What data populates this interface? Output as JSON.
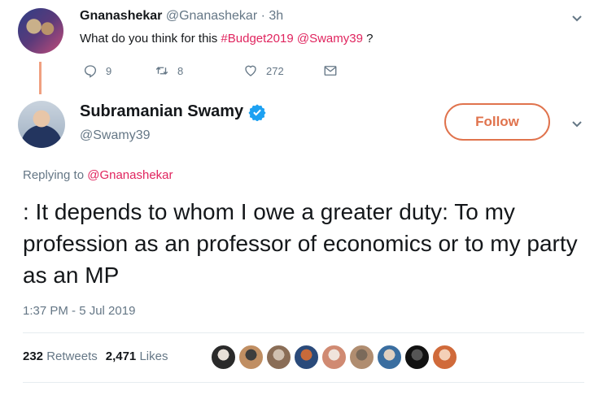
{
  "tweet1": {
    "name": "Gnanashekar",
    "meta": "@Gnanashekar · 3h",
    "text_prefix": "What do you think for this ",
    "hashtag": "#Budget2019",
    "mention": "@Swamy39",
    "text_suffix": " ?",
    "reply_count": "9",
    "retweet_count": "8",
    "like_count": "272"
  },
  "tweet2": {
    "name": "Subramanian Swamy",
    "handle": "@Swamy39",
    "follow_label": "Follow",
    "replying_prefix": "Replying to ",
    "replying_mention": "@Gnanashekar",
    "text": ": It depends to whom I owe a greater duty: To my profession as an professor of economics or to my party as an MP",
    "timestamp": "1:37 PM - 5 Jul 2019",
    "retweets_count": "232",
    "retweets_label": "Retweets",
    "likes_count": "2,471",
    "likes_label": "Likes"
  },
  "icons": [
    "reply-icon",
    "retweet-icon",
    "heart-icon",
    "envelope-icon",
    "chevron-down-icon",
    "verified-badge-icon"
  ],
  "colors": {
    "accent": "#e0245e",
    "follow": "#e0734d",
    "secondary_text": "#657786",
    "verified": "#1da1f2"
  },
  "likers": [
    {
      "color_a": "#2a2a2a",
      "color_b": "#e8e0d8"
    },
    {
      "color_a": "#c08e62",
      "color_b": "#3d3d3d"
    },
    {
      "color_a": "#8a6d56",
      "color_b": "#d0c0b0"
    },
    {
      "color_a": "#2a4a7a",
      "color_b": "#c86a3a"
    },
    {
      "color_a": "#d08a72",
      "color_b": "#f0e4dc"
    },
    {
      "color_a": "#b08d70",
      "color_b": "#7a6a5a"
    },
    {
      "color_a": "#3a6ea0",
      "color_b": "#e0d0c0"
    },
    {
      "color_a": "#111111",
      "color_b": "#555555"
    },
    {
      "color_a": "#d06a3a",
      "color_b": "#f4d0b8"
    }
  ]
}
